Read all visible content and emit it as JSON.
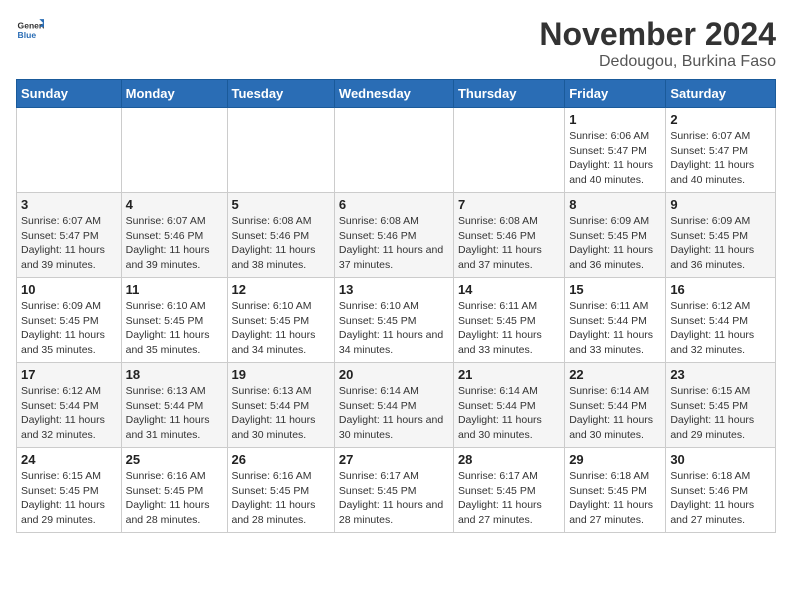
{
  "header": {
    "logo_general": "General",
    "logo_blue": "Blue",
    "month": "November 2024",
    "location": "Dedougou, Burkina Faso"
  },
  "weekdays": [
    "Sunday",
    "Monday",
    "Tuesday",
    "Wednesday",
    "Thursday",
    "Friday",
    "Saturday"
  ],
  "weeks": [
    [
      {
        "day": "",
        "info": ""
      },
      {
        "day": "",
        "info": ""
      },
      {
        "day": "",
        "info": ""
      },
      {
        "day": "",
        "info": ""
      },
      {
        "day": "",
        "info": ""
      },
      {
        "day": "1",
        "info": "Sunrise: 6:06 AM\nSunset: 5:47 PM\nDaylight: 11 hours and 40 minutes."
      },
      {
        "day": "2",
        "info": "Sunrise: 6:07 AM\nSunset: 5:47 PM\nDaylight: 11 hours and 40 minutes."
      }
    ],
    [
      {
        "day": "3",
        "info": "Sunrise: 6:07 AM\nSunset: 5:47 PM\nDaylight: 11 hours and 39 minutes."
      },
      {
        "day": "4",
        "info": "Sunrise: 6:07 AM\nSunset: 5:46 PM\nDaylight: 11 hours and 39 minutes."
      },
      {
        "day": "5",
        "info": "Sunrise: 6:08 AM\nSunset: 5:46 PM\nDaylight: 11 hours and 38 minutes."
      },
      {
        "day": "6",
        "info": "Sunrise: 6:08 AM\nSunset: 5:46 PM\nDaylight: 11 hours and 37 minutes."
      },
      {
        "day": "7",
        "info": "Sunrise: 6:08 AM\nSunset: 5:46 PM\nDaylight: 11 hours and 37 minutes."
      },
      {
        "day": "8",
        "info": "Sunrise: 6:09 AM\nSunset: 5:45 PM\nDaylight: 11 hours and 36 minutes."
      },
      {
        "day": "9",
        "info": "Sunrise: 6:09 AM\nSunset: 5:45 PM\nDaylight: 11 hours and 36 minutes."
      }
    ],
    [
      {
        "day": "10",
        "info": "Sunrise: 6:09 AM\nSunset: 5:45 PM\nDaylight: 11 hours and 35 minutes."
      },
      {
        "day": "11",
        "info": "Sunrise: 6:10 AM\nSunset: 5:45 PM\nDaylight: 11 hours and 35 minutes."
      },
      {
        "day": "12",
        "info": "Sunrise: 6:10 AM\nSunset: 5:45 PM\nDaylight: 11 hours and 34 minutes."
      },
      {
        "day": "13",
        "info": "Sunrise: 6:10 AM\nSunset: 5:45 PM\nDaylight: 11 hours and 34 minutes."
      },
      {
        "day": "14",
        "info": "Sunrise: 6:11 AM\nSunset: 5:45 PM\nDaylight: 11 hours and 33 minutes."
      },
      {
        "day": "15",
        "info": "Sunrise: 6:11 AM\nSunset: 5:44 PM\nDaylight: 11 hours and 33 minutes."
      },
      {
        "day": "16",
        "info": "Sunrise: 6:12 AM\nSunset: 5:44 PM\nDaylight: 11 hours and 32 minutes."
      }
    ],
    [
      {
        "day": "17",
        "info": "Sunrise: 6:12 AM\nSunset: 5:44 PM\nDaylight: 11 hours and 32 minutes."
      },
      {
        "day": "18",
        "info": "Sunrise: 6:13 AM\nSunset: 5:44 PM\nDaylight: 11 hours and 31 minutes."
      },
      {
        "day": "19",
        "info": "Sunrise: 6:13 AM\nSunset: 5:44 PM\nDaylight: 11 hours and 30 minutes."
      },
      {
        "day": "20",
        "info": "Sunrise: 6:14 AM\nSunset: 5:44 PM\nDaylight: 11 hours and 30 minutes."
      },
      {
        "day": "21",
        "info": "Sunrise: 6:14 AM\nSunset: 5:44 PM\nDaylight: 11 hours and 30 minutes."
      },
      {
        "day": "22",
        "info": "Sunrise: 6:14 AM\nSunset: 5:44 PM\nDaylight: 11 hours and 30 minutes."
      },
      {
        "day": "23",
        "info": "Sunrise: 6:15 AM\nSunset: 5:45 PM\nDaylight: 11 hours and 29 minutes."
      }
    ],
    [
      {
        "day": "24",
        "info": "Sunrise: 6:15 AM\nSunset: 5:45 PM\nDaylight: 11 hours and 29 minutes."
      },
      {
        "day": "25",
        "info": "Sunrise: 6:16 AM\nSunset: 5:45 PM\nDaylight: 11 hours and 28 minutes."
      },
      {
        "day": "26",
        "info": "Sunrise: 6:16 AM\nSunset: 5:45 PM\nDaylight: 11 hours and 28 minutes."
      },
      {
        "day": "27",
        "info": "Sunrise: 6:17 AM\nSunset: 5:45 PM\nDaylight: 11 hours and 28 minutes."
      },
      {
        "day": "28",
        "info": "Sunrise: 6:17 AM\nSunset: 5:45 PM\nDaylight: 11 hours and 27 minutes."
      },
      {
        "day": "29",
        "info": "Sunrise: 6:18 AM\nSunset: 5:45 PM\nDaylight: 11 hours and 27 minutes."
      },
      {
        "day": "30",
        "info": "Sunrise: 6:18 AM\nSunset: 5:46 PM\nDaylight: 11 hours and 27 minutes."
      }
    ]
  ]
}
